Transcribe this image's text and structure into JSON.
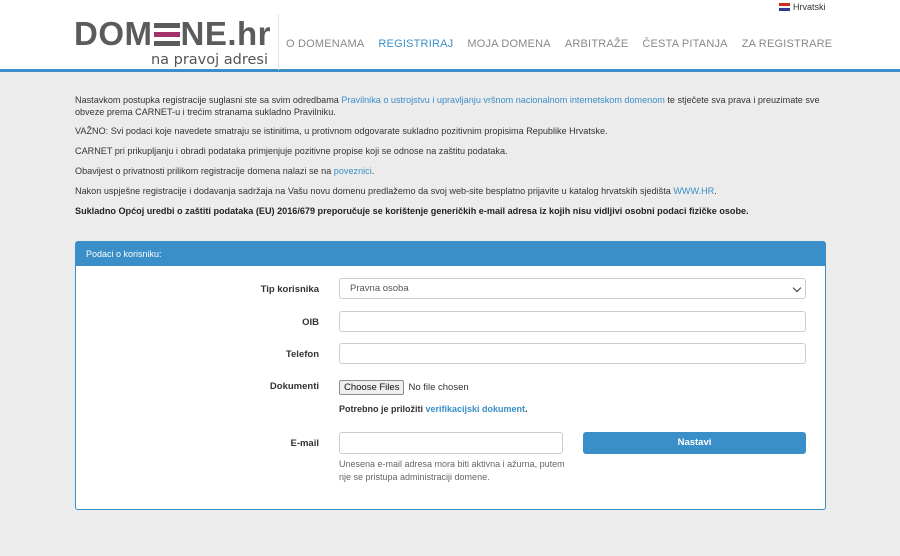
{
  "header": {
    "logo": {
      "part1": "DOM",
      "part2": "NE.hr",
      "tagline": "na pravoj adresi"
    },
    "language": {
      "label": "Hrvatski",
      "flag_icon": "croatia-flag-icon"
    },
    "nav": [
      {
        "label": "O DOMENAMA",
        "active": false
      },
      {
        "label": "REGISTRIRAJ",
        "active": true
      },
      {
        "label": "MOJA DOMENA",
        "active": false
      },
      {
        "label": "ARBITRAŽE",
        "active": false
      },
      {
        "label": "ČESTA PITANJA",
        "active": false
      },
      {
        "label": "ZA REGISTRARE",
        "active": false
      }
    ]
  },
  "intro": {
    "p1_before": "Nastavkom postupka registracije suglasni ste sa svim odredbama ",
    "p1_link": "Pravilnika o ustrojstvu i upravljanju vršnom nacionalnom internetskom domenom",
    "p1_after": " te stječete sva prava i preuzimate sve obveze prema CARNET-u i trećim stranama sukladno Pravilniku.",
    "p2": "VAŽNO: Svi podaci koje navedete smatraju se istinitima, u protivnom odgovarate sukladno pozitivnim propisima Republike Hrvatske.",
    "p3": "CARNET pri prikupljanju i obradi podataka primjenjuje pozitivne propise koji se odnose na zaštitu podataka.",
    "p4_before": "Obavijest o privatnosti prilikom registracije domena nalazi se na ",
    "p4_link": "poveznici",
    "p4_after": ".",
    "p5_before": "Nakon uspješne registracije i dodavanja sadržaja na Vašu novu domenu predlažemo da svoj web-site besplatno prijavite u katalog hrvatskih sjedišta ",
    "p5_link": "WWW.HR",
    "p5_after": ".",
    "p6": "Sukladno Općoj uredbi o zaštiti podataka (EU) 2016/679 preporučuje se korištenje generičkih e-mail adresa iz kojih nisu vidljivi osobni podaci fizičke osobe."
  },
  "form": {
    "title": "Podaci o korisniku:",
    "tip_label": "Tip korisnika",
    "tip_value": "Pravna osoba",
    "oib_label": "OIB",
    "oib_value": "",
    "telefon_label": "Telefon",
    "telefon_value": "",
    "dokumenti_label": "Dokumenti",
    "file_button": "Choose Files",
    "file_status": "No file chosen",
    "doc_hint_before": "Potrebno je priložiti ",
    "doc_hint_link": "verifikacijski dokument",
    "doc_hint_after": ".",
    "email_label": "E-mail",
    "email_value": "",
    "email_note": "Unesena e-mail adresa mora biti aktivna i ažurna, putem nje se pristupa administraciji domene.",
    "submit_label": "Nastavi"
  },
  "colors": {
    "accent": "#3a8fc8",
    "logo_accent": "#a3326a",
    "logo_gray": "#5b5b5b"
  }
}
